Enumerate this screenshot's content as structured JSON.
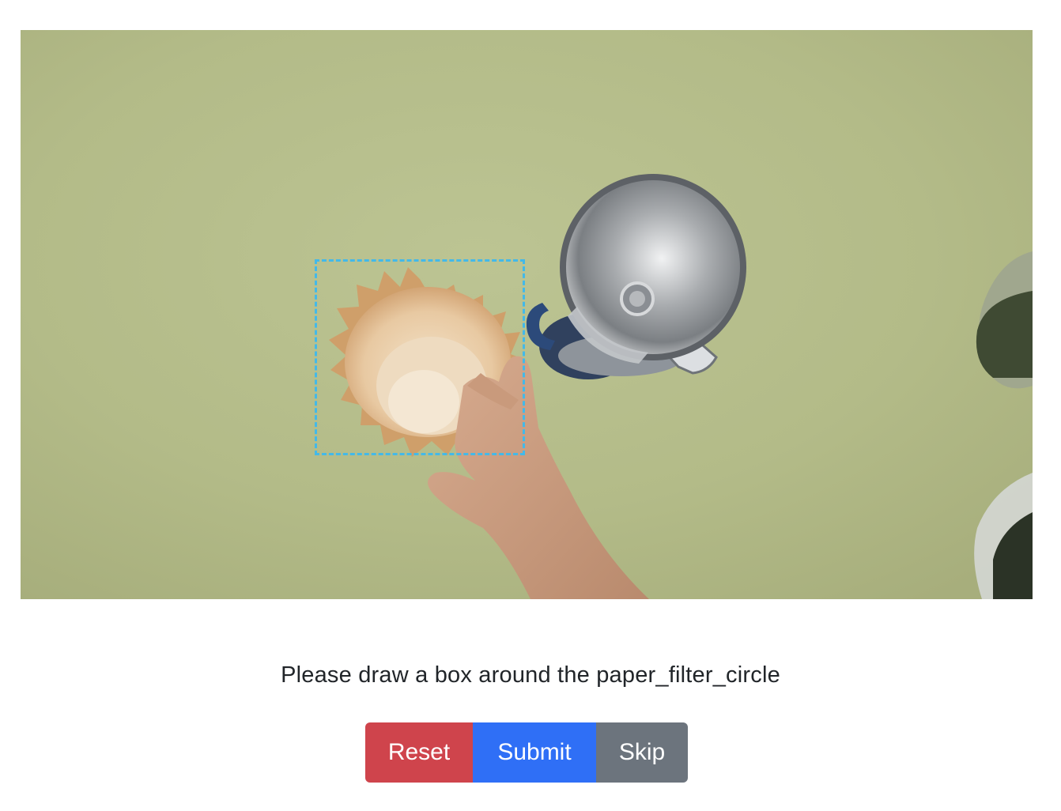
{
  "task": {
    "instruction": "Please draw a box around the paper_filter_circle",
    "target_label": "paper_filter_circle"
  },
  "image": {
    "description_icon": "tabletop-scene-image",
    "box_color": "#43b9e9"
  },
  "buttons": {
    "reset_label": "Reset",
    "submit_label": "Submit",
    "skip_label": "Skip"
  },
  "colors": {
    "reset": "#cf444c",
    "submit": "#2f6ff6",
    "skip": "#6c747d"
  }
}
